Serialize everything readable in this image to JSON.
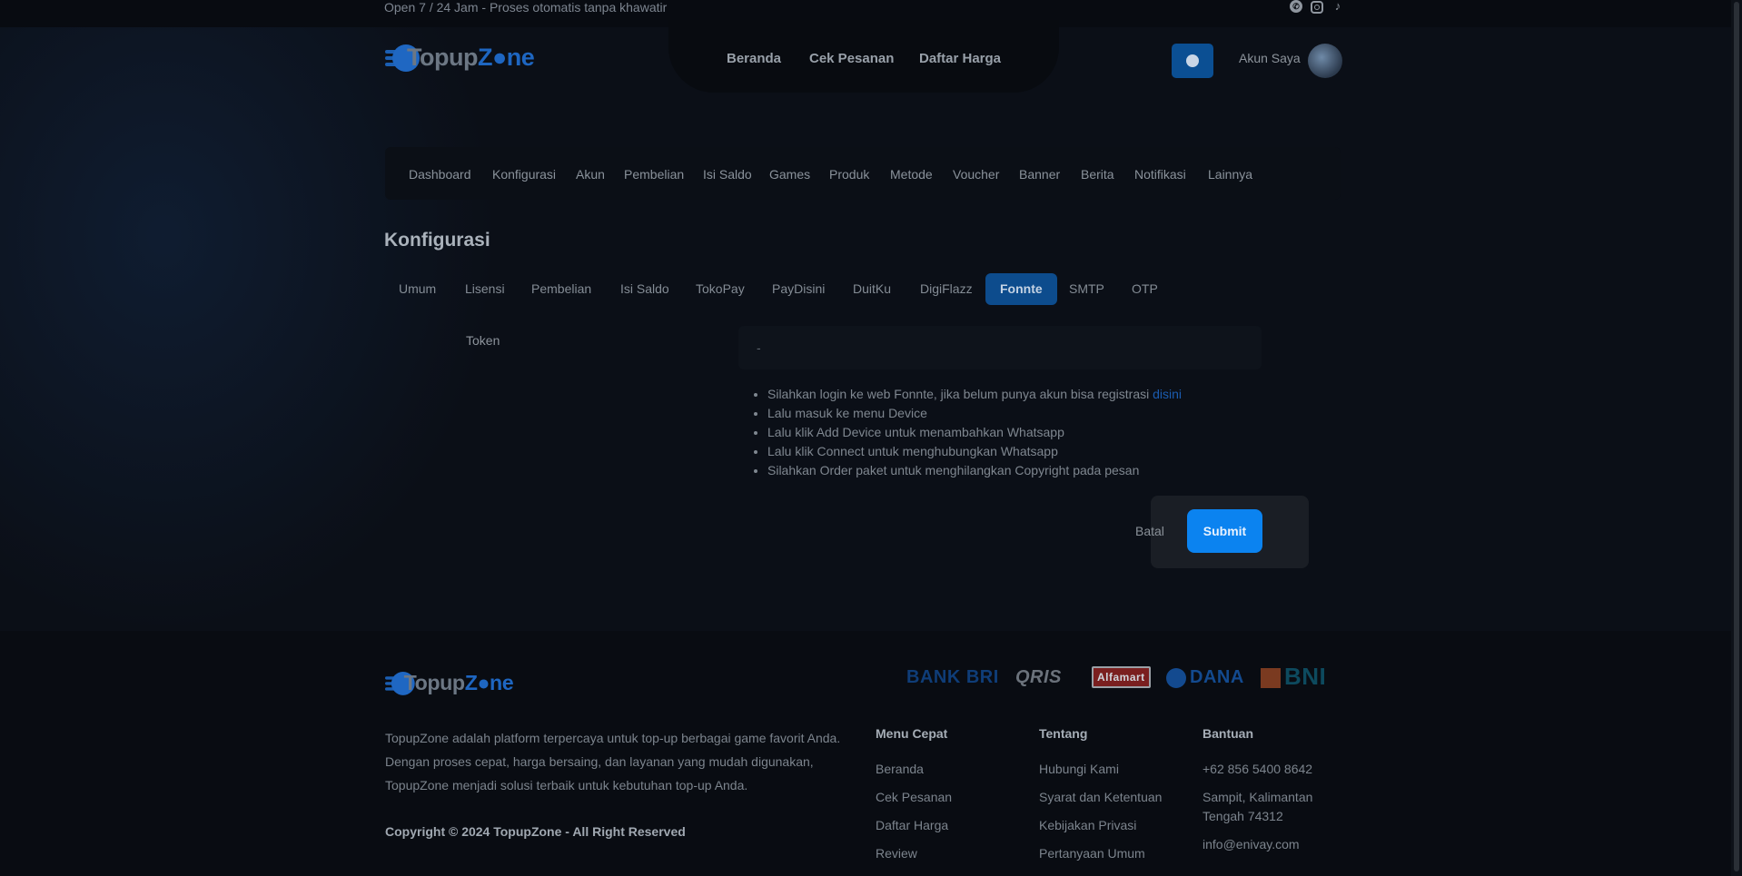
{
  "topbar": {
    "tagline": "Open 7 / 24 Jam - Proses otomatis tanpa khawatir",
    "social": [
      "whatsapp-icon",
      "instagram-icon",
      "tiktok-icon"
    ]
  },
  "brand": {
    "name_a": "Topup",
    "name_b": "Z",
    "name_c": "ne"
  },
  "nav": [
    "Beranda",
    "Cek Pesanan",
    "Daftar Harga"
  ],
  "account": {
    "label": "Akun Saya"
  },
  "admin_menu": [
    "Dashboard",
    "Konfigurasi",
    "Akun",
    "Pembelian",
    "Isi Saldo",
    "Games",
    "Produk",
    "Metode",
    "Voucher",
    "Banner",
    "Berita",
    "Notifikasi",
    "Lainnya"
  ],
  "page_title": "Konfigurasi",
  "tabs": [
    "Umum",
    "Lisensi",
    "Pembelian",
    "Isi Saldo",
    "TokoPay",
    "PayDisini",
    "DuitKu",
    "DigiFlazz",
    "Fonnte",
    "SMTP",
    "OTP"
  ],
  "active_tab": "Fonnte",
  "form": {
    "token_label": "Token",
    "token_value": "-",
    "hints": [
      "Silahkan login ke web Fonnte, jika belum punya akun bisa registrasi ",
      "Lalu masuk ke menu Device",
      "Lalu klik Add Device untuk menambahkan Whatsapp",
      "Lalu klik Connect untuk menghubungkan Whatsapp",
      "Silahkan Order paket untuk menghilangkan Copyright pada pesan"
    ],
    "hint_link": "disini",
    "cancel_label": "Batal",
    "submit_label": "Submit"
  },
  "footer": {
    "payments": {
      "bri": "BANK BRI",
      "qris": "QRIS",
      "alfamart": "Alfamart",
      "dana": "DANA",
      "bni": "BNI"
    },
    "about": "TopupZone adalah platform terpercaya untuk top-up berbagai game favorit Anda. Dengan proses cepat, harga bersaing, dan layanan yang mudah digunakan, TopupZone menjadi solusi terbaik untuk kebutuhan top-up Anda.",
    "copyright": "Copyright © 2024 TopupZone - All Right Reserved",
    "menu_cepat": {
      "title": "Menu Cepat",
      "links": [
        "Beranda",
        "Cek Pesanan",
        "Daftar Harga",
        "Review"
      ]
    },
    "tentang": {
      "title": "Tentang",
      "links": [
        "Hubungi Kami",
        "Syarat dan Ketentuan",
        "Kebijakan Privasi",
        "Pertanyaan Umum"
      ]
    },
    "bantuan": {
      "title": "Bantuan",
      "phone": "+62 856 5400 8642",
      "address_1": "Sampit, Kalimantan",
      "address_2": "Tengah 74312",
      "email": "info@enivay.com"
    }
  },
  "colors": {
    "accent": "#0b83f0",
    "active_tab": "#0d4c8d",
    "background": "#0b0f17"
  }
}
